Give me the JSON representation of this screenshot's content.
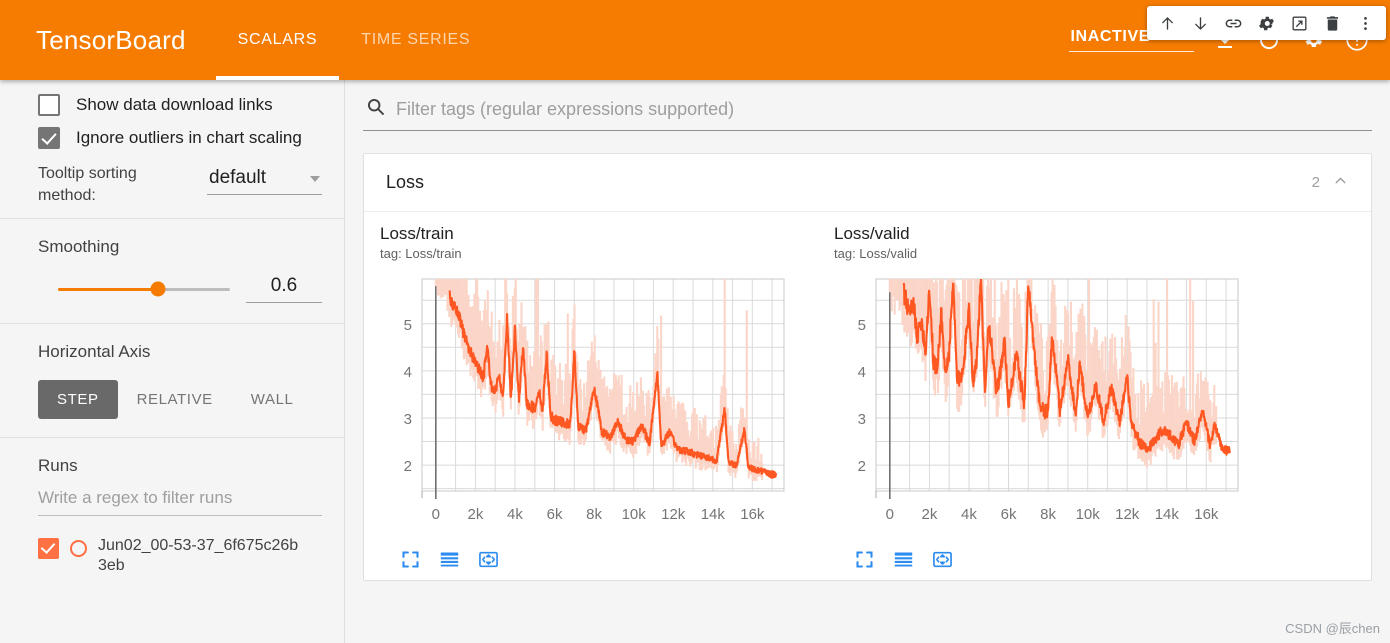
{
  "header": {
    "brand": "TensorBoard",
    "tabs": [
      {
        "label": "SCALARS",
        "active": true
      },
      {
        "label": "TIME SERIES",
        "active": false
      }
    ],
    "status_select": "INACTIVE",
    "icons": [
      "chevron-down-icon",
      "download-icon",
      "refresh-icon",
      "settings-gear-icon",
      "help-circle-icon"
    ]
  },
  "float_toolbar": {
    "icons": [
      "arrow-up-icon",
      "arrow-down-icon",
      "link-icon",
      "gear-icon",
      "popout-window-icon",
      "trash-icon",
      "more-vertical-icon"
    ]
  },
  "sidebar": {
    "checkboxes": [
      {
        "label": "Show data download links",
        "checked": false
      },
      {
        "label": "Ignore outliers in chart scaling",
        "checked": true
      }
    ],
    "tooltip_sorting": {
      "label": "Tooltip sorting method:",
      "value": "default"
    },
    "smoothing": {
      "title": "Smoothing",
      "value": "0.6"
    },
    "horizontal_axis": {
      "title": "Horizontal Axis",
      "options": [
        {
          "label": "STEP",
          "active": true
        },
        {
          "label": "RELATIVE",
          "active": false
        },
        {
          "label": "WALL",
          "active": false
        }
      ]
    },
    "runs": {
      "title": "Runs",
      "filter_placeholder": "Write a regex to filter runs",
      "items": [
        {
          "name": "Jun02_00-53-37_6f675c26b3eb",
          "checked": true,
          "color": "#ff7043"
        }
      ]
    }
  },
  "main": {
    "filter_placeholder": "Filter tags (regular expressions supported)",
    "card": {
      "title": "Loss",
      "count": "2",
      "collapse_icon": "chevron-up-icon"
    },
    "chart_actions": [
      "expand-icon",
      "data-table-icon",
      "fit-domain-icon"
    ]
  },
  "watermark": "CSDN @辰chen",
  "colors": {
    "header_orange": "#f57c00",
    "series_orange": "#ff5722",
    "series_faded": "#fbd5c8",
    "action_blue": "#2d8cf0",
    "run_orange": "#ff7043"
  },
  "chart_data": [
    {
      "type": "line",
      "title": "Loss/train",
      "tag": "tag: Loss/train",
      "xlabel": "",
      "ylabel": "",
      "xlim": [
        -700,
        17600
      ],
      "ylim": [
        1.45,
        5.95
      ],
      "xticks": [
        0,
        2000,
        4000,
        6000,
        8000,
        10000,
        12000,
        14000,
        16000
      ],
      "xticklabels": [
        "0",
        "2k",
        "4k",
        "6k",
        "8k",
        "10k",
        "12k",
        "14k",
        "16k"
      ],
      "yticks": [
        2,
        3,
        4,
        5
      ],
      "yticklabels": [
        "2",
        "3",
        "4",
        "5"
      ],
      "grid": true,
      "gridstep_y": 0.5,
      "gridstep_x": 1000,
      "legend": "none",
      "series": [
        {
          "name": "Jun02_00-53-37_6f675c26b3eb (smoothed)",
          "color": "#ff5722",
          "x": [
            400,
            600,
            800,
            1000,
            1200,
            1400,
            1600,
            1800,
            2000,
            2200,
            2400,
            2600,
            2800,
            3000,
            3200,
            3400,
            3600,
            3800,
            4000,
            4200,
            4400,
            4600,
            4800,
            5000,
            5200,
            5400,
            5600,
            5800,
            6000,
            6400,
            6800,
            7000,
            7200,
            7600,
            8000,
            8400,
            8800,
            9200,
            9600,
            10000,
            10400,
            10800,
            11200,
            11400,
            11800,
            12200,
            12600,
            13000,
            13400,
            13800,
            14200,
            14600,
            14800,
            15200,
            15600,
            15800,
            16200,
            16600,
            17000
          ],
          "y": [
            6.0,
            5.7,
            5.45,
            5.3,
            5.1,
            4.8,
            4.55,
            4.35,
            4.2,
            4.0,
            3.85,
            4.5,
            3.7,
            3.55,
            3.9,
            3.45,
            5.15,
            3.4,
            4.9,
            3.35,
            4.5,
            3.3,
            3.25,
            3.2,
            3.6,
            3.15,
            4.4,
            3.05,
            2.95,
            2.9,
            2.85,
            4.4,
            2.8,
            2.75,
            3.65,
            2.7,
            2.6,
            2.9,
            2.55,
            2.5,
            2.85,
            2.45,
            3.95,
            2.4,
            2.7,
            2.35,
            2.3,
            2.25,
            2.2,
            2.15,
            2.1,
            3.2,
            2.05,
            2.0,
            2.75,
            1.95,
            1.9,
            1.85,
            1.8
          ]
        },
        {
          "name": "Jun02_00-53-37_6f675c26b3eb (raw)",
          "color": "#fbd5c8",
          "note": "unsmoothed band, spans roughly 0.3-2.5 above and 0.2-0.4 below the smoothed trace; spikes reach above chart top near 4k, 5.5k, 7k, 11.4k"
        }
      ],
      "final_marker": {
        "x": 17000,
        "y": 1.8
      }
    },
    {
      "type": "line",
      "title": "Loss/valid",
      "tag": "tag: Loss/valid",
      "xlabel": "",
      "ylabel": "",
      "xlim": [
        -700,
        17600
      ],
      "ylim": [
        1.45,
        5.95
      ],
      "xticks": [
        0,
        2000,
        4000,
        6000,
        8000,
        10000,
        12000,
        14000,
        16000
      ],
      "xticklabels": [
        "0",
        "2k",
        "4k",
        "6k",
        "8k",
        "10k",
        "12k",
        "14k",
        "16k"
      ],
      "yticks": [
        2,
        3,
        4,
        5
      ],
      "yticklabels": [
        "2",
        "3",
        "4",
        "5"
      ],
      "grid": true,
      "gridstep_y": 0.5,
      "gridstep_x": 1000,
      "legend": "none",
      "series": [
        {
          "name": "Jun02_00-53-37_6f675c26b3eb (smoothed)",
          "color": "#ff5722",
          "x": [
            400,
            600,
            800,
            1000,
            1200,
            1400,
            1600,
            1800,
            2000,
            2200,
            2400,
            2600,
            2800,
            3000,
            3200,
            3400,
            3600,
            3800,
            4000,
            4200,
            4400,
            4600,
            4800,
            5000,
            5400,
            5800,
            6000,
            6400,
            6800,
            7000,
            7200,
            7600,
            8000,
            8200,
            8600,
            9000,
            9400,
            9600,
            10000,
            10400,
            10800,
            11200,
            11600,
            12000,
            12200,
            12600,
            13000,
            13400,
            13800,
            14200,
            14600,
            15000,
            15400,
            15800,
            16200,
            16400,
            16800,
            17000
          ],
          "y": [
            6.0,
            5.8,
            5.5,
            5.2,
            5.4,
            4.7,
            5.1,
            4.4,
            5.75,
            4.2,
            4.0,
            5.25,
            3.9,
            4.4,
            5.85,
            3.8,
            3.85,
            4.45,
            5.4,
            3.75,
            4.3,
            5.95,
            3.6,
            5.05,
            3.5,
            4.6,
            3.3,
            4.35,
            3.25,
            5.9,
            4.85,
            3.2,
            3.1,
            4.75,
            3.15,
            4.25,
            3.05,
            4.15,
            3.0,
            3.7,
            2.95,
            3.65,
            2.9,
            3.85,
            2.85,
            2.5,
            2.3,
            2.55,
            2.75,
            2.6,
            2.45,
            2.9,
            2.5,
            3.15,
            2.4,
            2.85,
            2.35,
            2.3
          ]
        },
        {
          "name": "Jun02_00-53-37_6f675c26b3eb (raw)",
          "color": "#fbd5c8",
          "note": "unsmoothed band with wide spread, spikes above chart top at 1k-5k and near 7k, 8.5k, 10k, 12k; lower envelope approaches 1.6 after 12k"
        }
      ],
      "final_marker": {
        "x": 17000,
        "y": 2.32
      }
    }
  ]
}
